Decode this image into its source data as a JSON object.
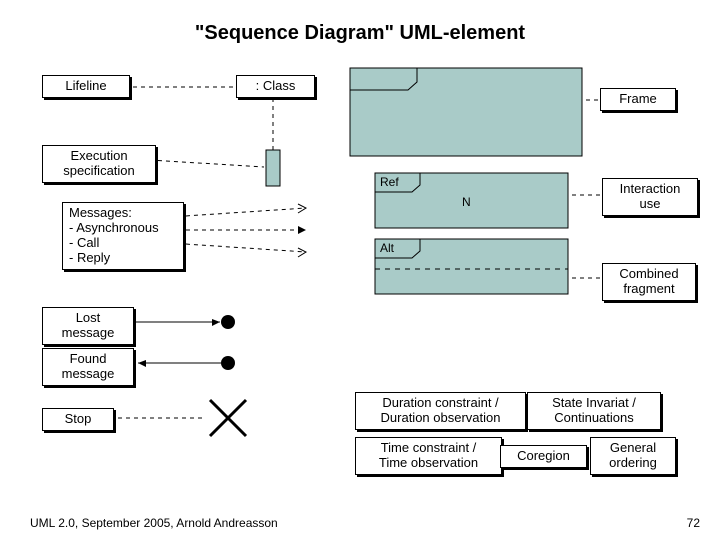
{
  "title": "\"Sequence Diagram\" UML-element",
  "labels": {
    "lifeline": "Lifeline",
    "class": ": Class",
    "frame": "Frame",
    "exec": "Execution\nspecification",
    "messages": "Messages:\n- Asynchronous\n- Call\n- Reply",
    "lost": "Lost\nmessage",
    "found": "Found\nmessage",
    "stop": "Stop",
    "interaction": "Interaction\nuse",
    "combined": "Combined\nfragment",
    "duration": "Duration constraint /\nDuration observation",
    "state": "State Invariat /\nContinuations",
    "time": "Time constraint /\nTime observation",
    "coregion": "Coregion",
    "general": "General\nordering",
    "ref_tab": "Ref",
    "alt_tab": "Alt",
    "n": "N"
  },
  "footer": "UML 2.0, September 2005, Arnold Andreasson",
  "page": "72"
}
